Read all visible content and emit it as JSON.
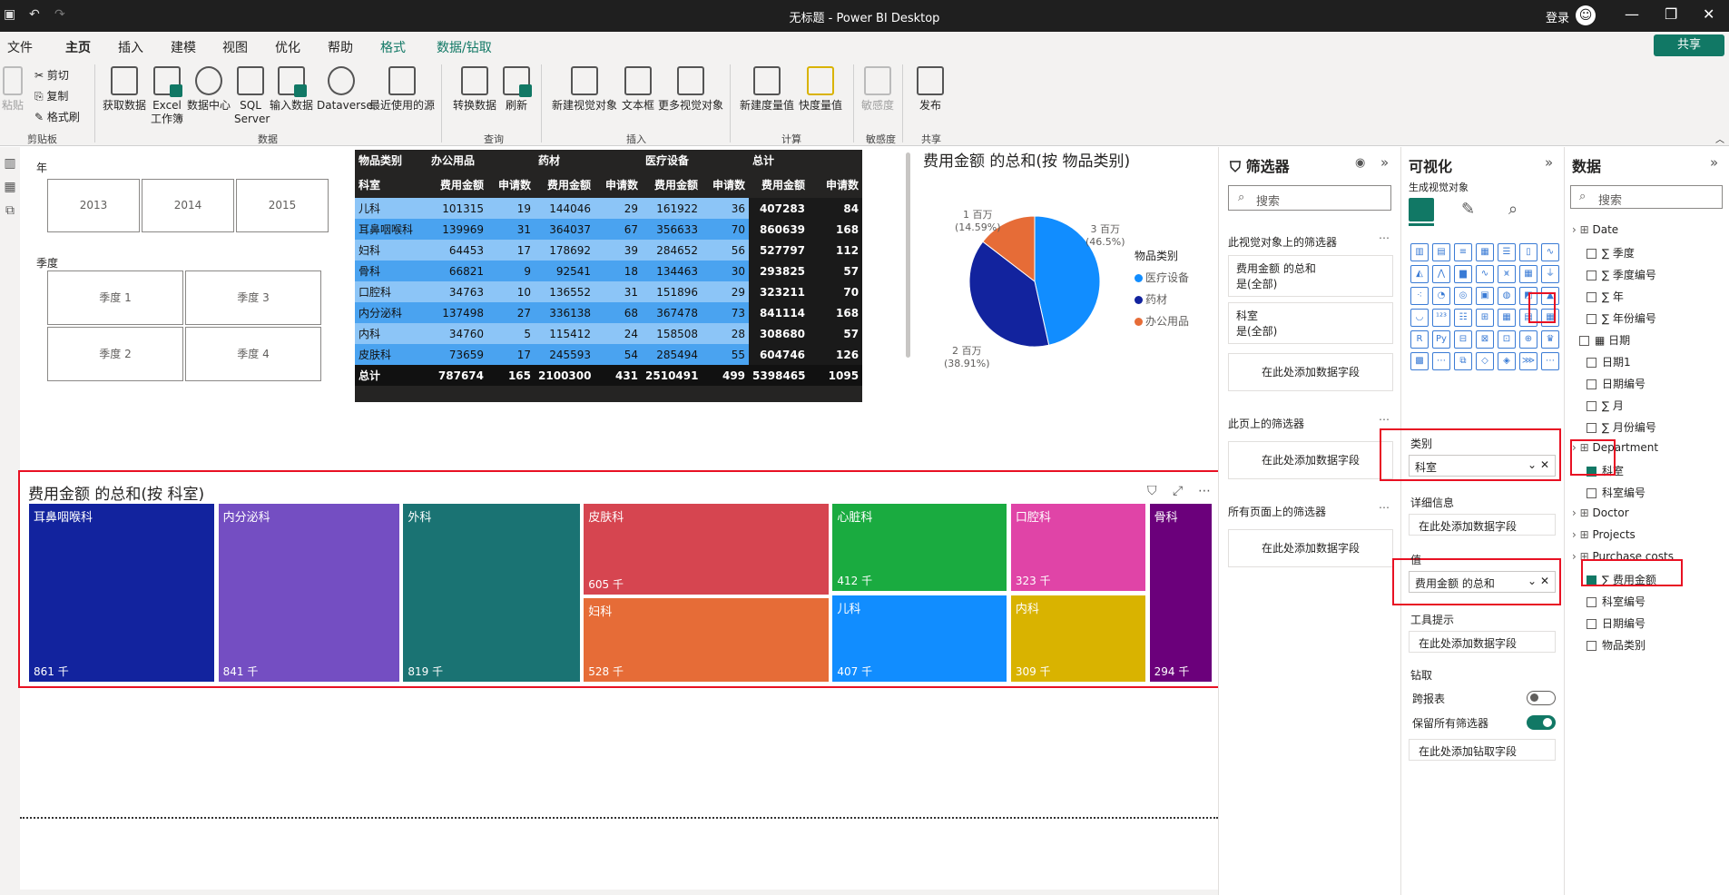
{
  "window": {
    "title": "无标题 - Power BI Desktop",
    "login": "登录"
  },
  "menu": {
    "tabs": [
      "文件",
      "主页",
      "插入",
      "建模",
      "视图",
      "优化",
      "帮助",
      "格式",
      "数据/钻取"
    ],
    "active": "主页",
    "share": "共享"
  },
  "ribbon": {
    "clipboard": {
      "paste": "粘贴",
      "cut": "剪切",
      "copy": "复制",
      "format_painter": "格式刷",
      "group": "剪贴板"
    },
    "data": {
      "get_data": "获取数据",
      "excel": "Excel\n工作簿",
      "data_hub": "数据中心",
      "sql": "SQL\nServer",
      "enter_data": "输入数据",
      "dataverse": "Dataverse",
      "recent": "最近使用的源",
      "group": "数据"
    },
    "queries": {
      "transform": "转换数据",
      "refresh": "刷新",
      "group": "查询"
    },
    "insert": {
      "new_visual": "新建视觉对象",
      "textbox": "文本框",
      "more_visuals": "更多视觉对象",
      "group": "插入"
    },
    "calc": {
      "new_measure": "新建度量值",
      "quick_measure": "快度量值",
      "group": "计算"
    },
    "sensitivity": {
      "label": "敏感度",
      "group": "敏感度"
    },
    "share": {
      "publish": "发布",
      "group": "共享"
    }
  },
  "slicers": {
    "year": {
      "title": "年",
      "items": [
        "2013",
        "2014",
        "2015"
      ]
    },
    "quarter": {
      "title": "季度",
      "items": [
        "季度 1",
        "季度 3",
        "季度 2",
        "季度 4"
      ]
    }
  },
  "matrix": {
    "groups": [
      "物品类别",
      "办公用品",
      "药材",
      "医疗设备",
      "总计"
    ],
    "subheaders": [
      "科室",
      "费用金额",
      "申请数",
      "费用金额",
      "申请数",
      "费用金额",
      "申请数",
      "费用金额",
      "申请数"
    ],
    "rows": [
      [
        "儿科",
        "101315",
        "19",
        "144046",
        "29",
        "161922",
        "36",
        "407283",
        "84"
      ],
      [
        "耳鼻咽喉科",
        "139969",
        "31",
        "364037",
        "67",
        "356633",
        "70",
        "860639",
        "168"
      ],
      [
        "妇科",
        "64453",
        "17",
        "178692",
        "39",
        "284652",
        "56",
        "527797",
        "112"
      ],
      [
        "骨科",
        "66821",
        "9",
        "92541",
        "18",
        "134463",
        "30",
        "293825",
        "57"
      ],
      [
        "口腔科",
        "34763",
        "10",
        "136552",
        "31",
        "151896",
        "29",
        "323211",
        "70"
      ],
      [
        "内分泌科",
        "137498",
        "27",
        "336138",
        "68",
        "367478",
        "73",
        "841114",
        "168"
      ],
      [
        "内科",
        "34760",
        "5",
        "115412",
        "24",
        "158508",
        "28",
        "308680",
        "57"
      ],
      [
        "皮肤科",
        "73659",
        "17",
        "245593",
        "54",
        "285494",
        "55",
        "604746",
        "126"
      ]
    ],
    "total": [
      "总计",
      "787674",
      "165",
      "2100300",
      "431",
      "2510491",
      "499",
      "5398465",
      "1095"
    ]
  },
  "pie": {
    "title": "费用金额 的总和(按 物品类别)",
    "legend_title": "物品类别",
    "labels": [
      {
        "value": "3 百万",
        "pct": "(46.5%)"
      },
      {
        "value": "2 百万",
        "pct": "(38.91%)"
      },
      {
        "value": "1 百万",
        "pct": "(14.59%)"
      }
    ]
  },
  "chart_data": {
    "type": "pie",
    "title": "费用金额 的总和(按 物品类别)",
    "legend_title": "物品类别",
    "categories": [
      "医疗设备",
      "药材",
      "办公用品"
    ],
    "values": [
      2510491,
      2100300,
      787674
    ],
    "percent": [
      46.5,
      38.91,
      14.59
    ],
    "colors": [
      "#118dff",
      "#12239e",
      "#e66c37"
    ]
  },
  "treemap": {
    "title": "费用金额 的总和(按 科室)",
    "tiles": [
      {
        "name": "耳鼻咽喉科",
        "value": "861 千",
        "color": "#12239e"
      },
      {
        "name": "内分泌科",
        "value": "841 千",
        "color": "#744ec2"
      },
      {
        "name": "外科",
        "value": "819 千",
        "color": "#1a7373"
      },
      {
        "name": "皮肤科",
        "value": "605 千",
        "color": "#d64550"
      },
      {
        "name": "妇科",
        "value": "528 千",
        "color": "#e66c37"
      },
      {
        "name": "心脏科",
        "value": "412 千",
        "color": "#1aab40"
      },
      {
        "name": "儿科",
        "value": "407 千",
        "color": "#118dff"
      },
      {
        "name": "口腔科",
        "value": "323 千",
        "color": "#e044a7"
      },
      {
        "name": "内科",
        "value": "309 千",
        "color": "#d9b300"
      },
      {
        "name": "骨科",
        "value": "294 千",
        "color": "#6b007b"
      }
    ]
  },
  "filters": {
    "title": "筛选器",
    "search": "搜索",
    "visual_section": "此视觉对象上的筛选器",
    "cards": [
      {
        "l1": "费用金额 的总和",
        "l2": "是(全部)"
      },
      {
        "l1": "科室",
        "l2": "是(全部)"
      }
    ],
    "add": "在此处添加数据字段",
    "page_section": "此页上的筛选器",
    "all_section": "所有页面上的筛选器"
  },
  "viz": {
    "title": "可视化",
    "build": "生成视觉对象",
    "category_label": "类别",
    "category_value": "科室",
    "details_label": "详细信息",
    "details_add": "在此处添加数据字段",
    "values_label": "值",
    "values_value": "费用金额 的总和",
    "tooltip_label": "工具提示",
    "tooltip_add": "在此处添加数据字段",
    "drill_label": "钻取",
    "cross_report": "跨报表",
    "keep_filters": "保留所有筛选器",
    "drill_add": "在此处添加钻取字段"
  },
  "data": {
    "title": "数据",
    "search": "搜索",
    "items": [
      {
        "label": "Date",
        "indent": 0,
        "type": "table"
      },
      {
        "label": "季度",
        "indent": 2,
        "type": "sigma"
      },
      {
        "label": "季度编号",
        "indent": 2,
        "type": "sigma"
      },
      {
        "label": "年",
        "indent": 2,
        "type": "sigma"
      },
      {
        "label": "年份编号",
        "indent": 2,
        "type": "sigma"
      },
      {
        "label": "日期",
        "indent": 1,
        "type": "cal"
      },
      {
        "label": "日期1",
        "indent": 2,
        "type": "plain"
      },
      {
        "label": "日期编号",
        "indent": 2,
        "type": "plain"
      },
      {
        "label": "月",
        "indent": 2,
        "type": "sigma"
      },
      {
        "label": "月份编号",
        "indent": 2,
        "type": "sigma"
      },
      {
        "label": "Department",
        "indent": 0,
        "type": "table"
      },
      {
        "label": "科室",
        "indent": 2,
        "type": "checked"
      },
      {
        "label": "科室编号",
        "indent": 2,
        "type": "plain"
      },
      {
        "label": "Doctor",
        "indent": 0,
        "type": "table"
      },
      {
        "label": "Projects",
        "indent": 0,
        "type": "table"
      },
      {
        "label": "Purchase costs",
        "indent": 0,
        "type": "table"
      },
      {
        "label": "费用金额",
        "indent": 2,
        "type": "checked-sigma"
      },
      {
        "label": "科室编号",
        "indent": 2,
        "type": "plain"
      },
      {
        "label": "日期编号",
        "indent": 2,
        "type": "plain"
      },
      {
        "label": "物品类别",
        "indent": 2,
        "type": "plain"
      }
    ]
  }
}
